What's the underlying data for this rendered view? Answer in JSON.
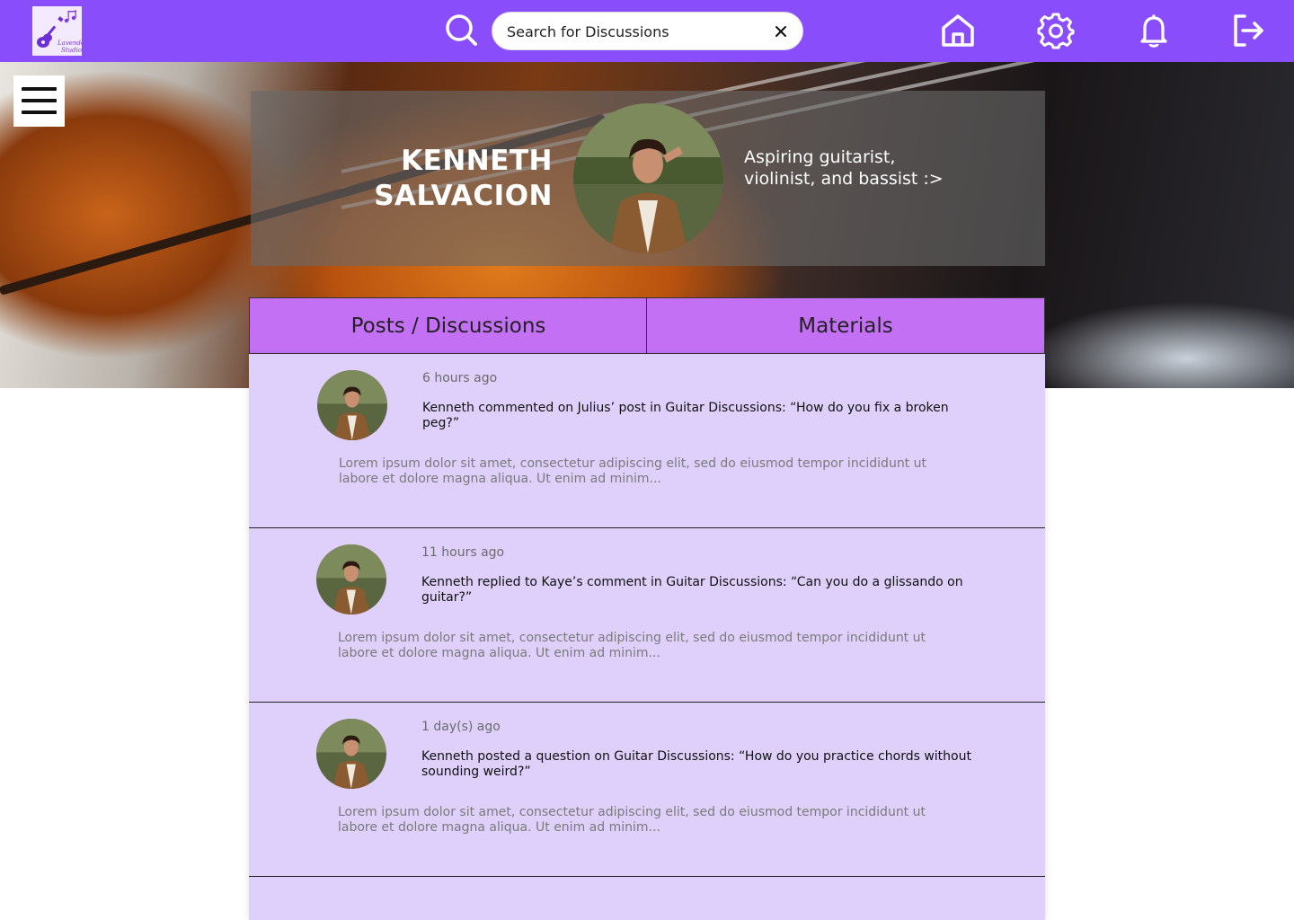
{
  "header": {
    "logo_text": "Lavender Studio",
    "search": {
      "placeholder": "Search for Discussions",
      "value": ""
    },
    "icons": [
      "search-icon",
      "close-icon",
      "home-icon",
      "gear-icon",
      "bell-icon",
      "logout-icon"
    ]
  },
  "profile": {
    "name_line1": "KENNETH",
    "name_line2": "SALVACION",
    "bio": "Aspiring guitarist, violinist, and bassist :>"
  },
  "tabs": [
    {
      "label": "Posts / Discussions"
    },
    {
      "label": "Materials"
    }
  ],
  "posts": [
    {
      "time": "6 hours ago",
      "title": "Kenneth commented on Julius’ post in Guitar Discussions: “How do you fix a broken peg?”",
      "excerpt": "Lorem ipsum dolor sit amet, consectetur adipiscing elit, sed do eiusmod tempor incididunt ut labore et dolore magna aliqua. Ut enim ad minim..."
    },
    {
      "time": "11 hours ago",
      "title": "Kenneth replied to Kaye’s comment in Guitar Discussions: “Can you do a glissando on guitar?”",
      "excerpt": "Lorem ipsum dolor sit amet, consectetur adipiscing elit, sed do eiusmod tempor incididunt ut labore et dolore magna aliqua. Ut enim ad minim..."
    },
    {
      "time": "1 day(s) ago",
      "title": "Kenneth posted a question on Guitar Discussions: “How do you practice chords without sounding weird?”",
      "excerpt": "Lorem ipsum dolor sit amet, consectetur adipiscing elit, sed do eiusmod tempor incididunt ut labore et dolore magna aliqua. Ut enim ad minim..."
    }
  ],
  "colors": {
    "brand": "#8a4dfc",
    "tab": "#c470f5",
    "feed": "#dfd0fb"
  }
}
